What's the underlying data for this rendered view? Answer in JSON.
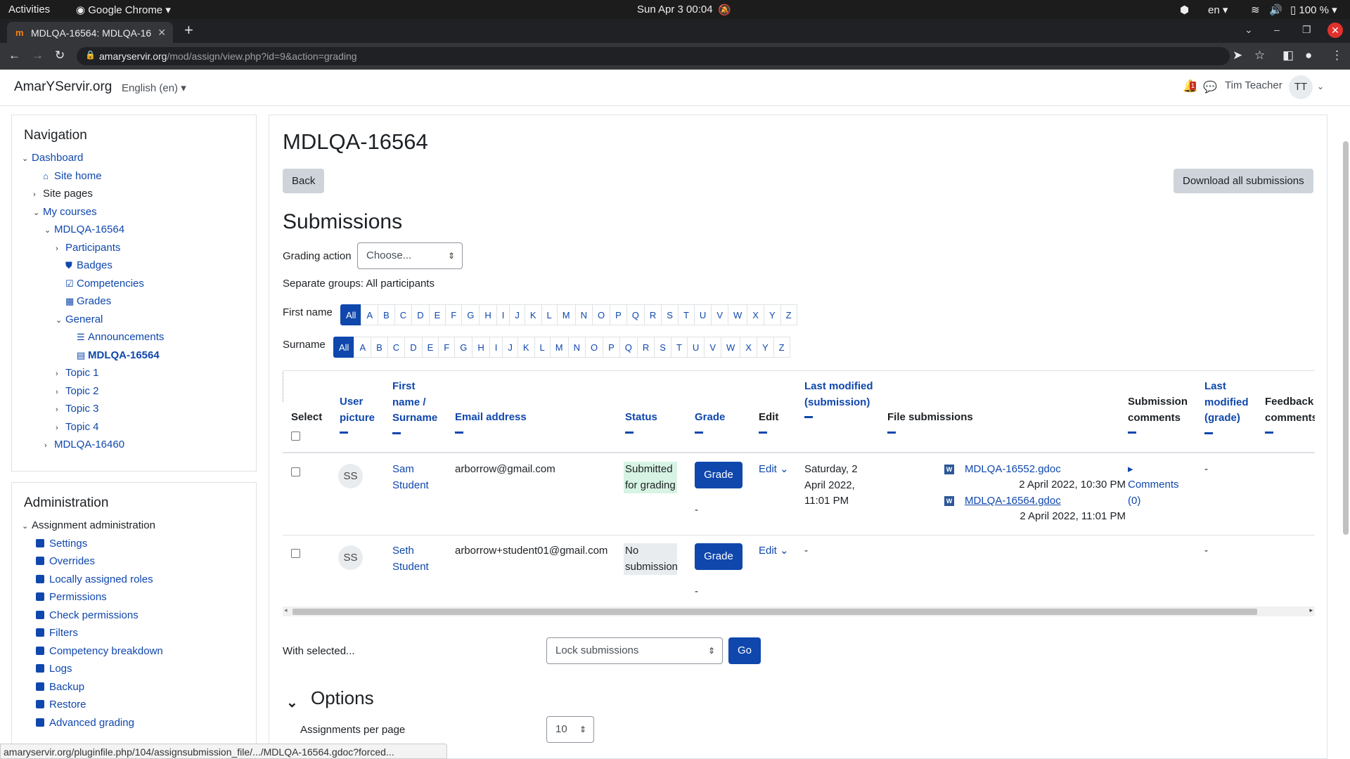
{
  "os": {
    "activities": "Activities",
    "app": "Google Chrome",
    "clock": "Sun Apr 3  00:04",
    "lang": "en",
    "battery": "100 %"
  },
  "browser": {
    "tab_title": "MDLQA-16564: MDLQA-16",
    "url_host": "amaryservir.org",
    "url_path": "/mod/assign/view.php?id=9&action=grading"
  },
  "header": {
    "brand": "AmarYServir.org",
    "language": "English (en)",
    "user_name": "Tim Teacher",
    "user_initials": "TT",
    "notif_count": "1"
  },
  "nav": {
    "title": "Navigation",
    "items": [
      {
        "label": "Dashboard",
        "level": 0,
        "chev": "v",
        "icon": ""
      },
      {
        "label": "Site home",
        "level": 1,
        "chev": "",
        "icon": "home"
      },
      {
        "label": "Site pages",
        "level": 1,
        "chev": ">",
        "icon": ""
      },
      {
        "label": "My courses",
        "level": 1,
        "chev": "v",
        "icon": ""
      },
      {
        "label": "MDLQA-16564",
        "level": 2,
        "chev": "v",
        "icon": ""
      },
      {
        "label": "Participants",
        "level": 3,
        "chev": ">",
        "icon": ""
      },
      {
        "label": "Badges",
        "level": 3,
        "chev": "",
        "icon": "badge"
      },
      {
        "label": "Competencies",
        "level": 3,
        "chev": "",
        "icon": "check"
      },
      {
        "label": "Grades",
        "level": 3,
        "chev": "",
        "icon": "table"
      },
      {
        "label": "General",
        "level": 3,
        "chev": "v",
        "icon": ""
      },
      {
        "label": "Announcements",
        "level": 4,
        "chev": "",
        "icon": "forum"
      },
      {
        "label": "MDLQA-16564",
        "level": 4,
        "chev": "",
        "icon": "assign",
        "active": true
      },
      {
        "label": "Topic 1",
        "level": 3,
        "chev": ">",
        "icon": ""
      },
      {
        "label": "Topic 2",
        "level": 3,
        "chev": ">",
        "icon": ""
      },
      {
        "label": "Topic 3",
        "level": 3,
        "chev": ">",
        "icon": ""
      },
      {
        "label": "Topic 4",
        "level": 3,
        "chev": ">",
        "icon": ""
      },
      {
        "label": "MDLQA-16460",
        "level": 2,
        "chev": ">",
        "icon": ""
      }
    ]
  },
  "admin": {
    "title": "Administration",
    "group": "Assignment administration",
    "items": [
      "Settings",
      "Overrides",
      "Locally assigned roles",
      "Permissions",
      "Check permissions",
      "Filters",
      "Competency breakdown",
      "Logs",
      "Backup",
      "Restore",
      "Advanced grading"
    ]
  },
  "main": {
    "title": "MDLQA-16564",
    "back": "Back",
    "download_all": "Download all submissions",
    "submissions_heading": "Submissions",
    "grading_action_label": "Grading action",
    "grading_action_value": "Choose...",
    "groups": "Separate groups: All participants",
    "firstname_label": "First name",
    "surname_label": "Surname",
    "letters": [
      "All",
      "A",
      "B",
      "C",
      "D",
      "E",
      "F",
      "G",
      "H",
      "I",
      "J",
      "K",
      "L",
      "M",
      "N",
      "O",
      "P",
      "Q",
      "R",
      "S",
      "T",
      "U",
      "V",
      "W",
      "X",
      "Y",
      "Z"
    ],
    "columns": {
      "select": "Select",
      "userpic": "User picture",
      "name": "First name / Surname",
      "email": "Email address",
      "status": "Status",
      "grade": "Grade",
      "edit": "Edit",
      "lastmod_sub": "Last modified (submission)",
      "files": "File submissions",
      "sub_comments": "Submission comments",
      "lastmod_grade": "Last modified (grade)",
      "feedback": "Feedback comments"
    },
    "rows": [
      {
        "initials": "SS",
        "first": "Sam",
        "last": "Student",
        "email": "arborrow@gmail.com",
        "status": "Submitted for grading",
        "grade_btn": "Grade",
        "grade_val": "-",
        "edit": "Edit",
        "modified": "Saturday, 2 April 2022, 11:01 PM",
        "files": [
          {
            "name": "MDLQA-16552.gdoc",
            "date": "2 April 2022, 10:30 PM"
          },
          {
            "name": "MDLQA-16564.gdoc",
            "date": "2 April 2022, 11:01 PM"
          }
        ],
        "comments": "Comments (0)",
        "lastmod_grade": "-"
      },
      {
        "initials": "SS",
        "first": "Seth",
        "last": "Student",
        "email": "arborrow+student01@gmail.com",
        "status": "No submission",
        "grade_btn": "Grade",
        "grade_val": "-",
        "edit": "Edit",
        "modified": "-",
        "files": [],
        "comments": "",
        "lastmod_grade": "-"
      }
    ],
    "with_selected": "With selected...",
    "bulk_action": "Lock submissions",
    "go": "Go",
    "options_heading": "Options",
    "per_page_label": "Assignments per page",
    "per_page": "10"
  },
  "statusbar": "amaryservir.org/pluginfile.php/104/assignsubmission_file/.../MDLQA-16564.gdoc?forced..."
}
